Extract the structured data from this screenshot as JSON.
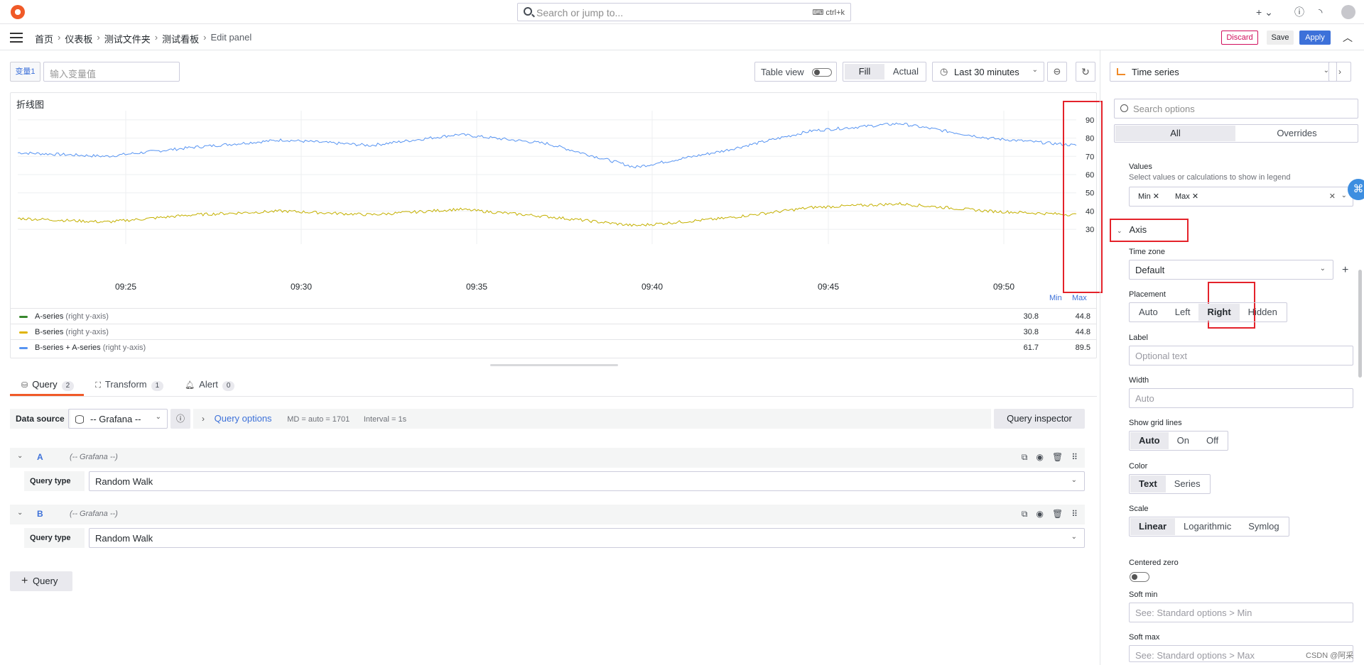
{
  "topbar": {
    "search_placeholder": "Search or jump to...",
    "search_shortcut": "⌨ ctrl+k",
    "icons": [
      "plus-icon",
      "help-icon",
      "rss-icon",
      "user-avatar"
    ]
  },
  "breadcrumbs": [
    "首页",
    "仪表板",
    "测试文件夹",
    "测试看板",
    "Edit panel"
  ],
  "actions": {
    "discard": "Discard",
    "save": "Save",
    "apply": "Apply"
  },
  "variables": {
    "label": "变量1",
    "placeholder": "输入变量值"
  },
  "toolbar": {
    "table_view": "Table view",
    "fill": "Fill",
    "actual": "Actual",
    "time_range": "Last 30 minutes"
  },
  "panel": {
    "title": "折线图",
    "x_ticks": [
      "09:25",
      "09:30",
      "09:35",
      "09:40",
      "09:45",
      "09:50"
    ],
    "y_ticks": [
      "90",
      "80",
      "70",
      "60",
      "50",
      "40",
      "30"
    ],
    "legend_headers": {
      "min": "Min",
      "max": "Max"
    },
    "legend": [
      {
        "name": "A-series",
        "axis": "(right y-axis)",
        "color": "#37872d",
        "min": "30.8",
        "max": "44.8"
      },
      {
        "name": "B-series",
        "axis": "(right y-axis)",
        "color": "#e0b400",
        "min": "30.8",
        "max": "44.8"
      },
      {
        "name": "B-series + A-series",
        "axis": "(right y-axis)",
        "color": "#5794f2",
        "min": "61.7",
        "max": "89.5"
      }
    ]
  },
  "chart_data": {
    "type": "line",
    "title": "折线图",
    "x": [
      "09:22",
      "09:25",
      "09:28",
      "09:30",
      "09:33",
      "09:35",
      "09:37",
      "09:40",
      "09:43",
      "09:45",
      "09:47",
      "09:50",
      "09:52"
    ],
    "series": [
      {
        "name": "B-series + A-series",
        "values": [
          72,
          70,
          75,
          79,
          76,
          82,
          77,
          64,
          73,
          84,
          88,
          80,
          76
        ]
      },
      {
        "name": "B-series",
        "values": [
          36,
          34,
          38,
          40,
          38,
          41,
          37,
          32,
          36,
          42,
          44,
          40,
          38
        ]
      }
    ],
    "ylim": [
      25,
      95
    ],
    "y_axis_placement": "right",
    "grid": true,
    "legend": "bottom"
  },
  "query_tabs": [
    {
      "label": "Query",
      "count": "2",
      "icon": "database-icon"
    },
    {
      "label": "Transform",
      "count": "1",
      "icon": "transform-icon"
    },
    {
      "label": "Alert",
      "count": "0",
      "icon": "bell-icon"
    }
  ],
  "query_row": {
    "ds_label": "Data source",
    "ds_value": "-- Grafana --",
    "options_title": "Query options",
    "md": "MD = auto = 1701",
    "interval": "Interval = 1s",
    "inspector": "Query inspector"
  },
  "queries": [
    {
      "ref": "A",
      "ds": "(-- Grafana --)",
      "type_label": "Query type",
      "type_value": "Random Walk"
    },
    {
      "ref": "B",
      "ds": "(-- Grafana --)",
      "type_label": "Query type",
      "type_value": "Random Walk"
    }
  ],
  "add_query": "Query",
  "options_pane": {
    "viz": "Time series",
    "search_placeholder": "Search options",
    "tabs": [
      "All",
      "Overrides"
    ],
    "values_label": "Values",
    "values_desc": "Select values or calculations to show in legend",
    "values_chips": [
      "Min",
      "Max"
    ],
    "axis_title": "Axis",
    "timezone_label": "Time zone",
    "timezone_value": "Default",
    "placement_label": "Placement",
    "placement_options": [
      "Auto",
      "Left",
      "Right",
      "Hidden"
    ],
    "placement_selected": "Right",
    "label_label": "Label",
    "label_placeholder": "Optional text",
    "width_label": "Width",
    "width_placeholder": "Auto",
    "grid_label": "Show grid lines",
    "grid_options": [
      "Auto",
      "On",
      "Off"
    ],
    "color_label": "Color",
    "color_options": [
      "Text",
      "Series"
    ],
    "scale_label": "Scale",
    "scale_options": [
      "Linear",
      "Logarithmic",
      "Symlog"
    ],
    "centered_zero_label": "Centered zero",
    "soft_min_label": "Soft min",
    "soft_min_placeholder": "See: Standard options > Min",
    "soft_max_label": "Soft max",
    "soft_max_placeholder": "See: Standard options > Max"
  },
  "watermark": "CSDN @阿采"
}
